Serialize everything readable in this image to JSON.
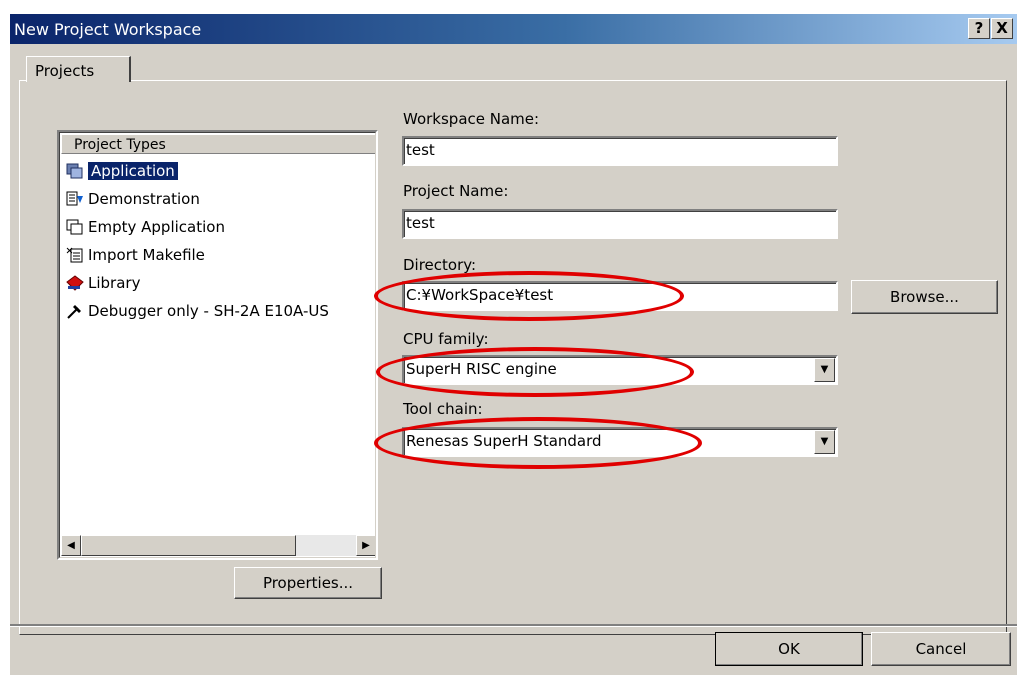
{
  "window": {
    "title": "New Project Workspace",
    "help_button": "?",
    "close_button": "X"
  },
  "tabs": [
    {
      "label": "Projects"
    }
  ],
  "project_types": {
    "header": "Project Types",
    "items": [
      {
        "label": "Application",
        "icon": "application-icon",
        "selected": true
      },
      {
        "label": "Demonstration",
        "icon": "demonstration-icon",
        "selected": false
      },
      {
        "label": "Empty Application",
        "icon": "empty-application-icon",
        "selected": false
      },
      {
        "label": "Import Makefile",
        "icon": "import-makefile-icon",
        "selected": false
      },
      {
        "label": "Library",
        "icon": "library-icon",
        "selected": false
      },
      {
        "label": "Debugger only - SH-2A E10A-US",
        "icon": "debugger-icon",
        "selected": false
      }
    ]
  },
  "buttons": {
    "properties": "Properties...",
    "browse": "Browse...",
    "ok": "OK",
    "cancel": "Cancel"
  },
  "form": {
    "workspace_name": {
      "label": "Workspace Name:",
      "value": "test"
    },
    "project_name": {
      "label": "Project Name:",
      "value": "test"
    },
    "directory": {
      "label": "Directory:",
      "value": "C:¥WorkSpace¥test"
    },
    "cpu_family": {
      "label": "CPU family:",
      "value": "SuperH RISC engine"
    },
    "tool_chain": {
      "label": "Tool chain:",
      "value": "Renesas SuperH Standard"
    }
  },
  "colors": {
    "annotation": "#e00000",
    "selection": "#0a246a",
    "title_bar": "#0a246a"
  }
}
